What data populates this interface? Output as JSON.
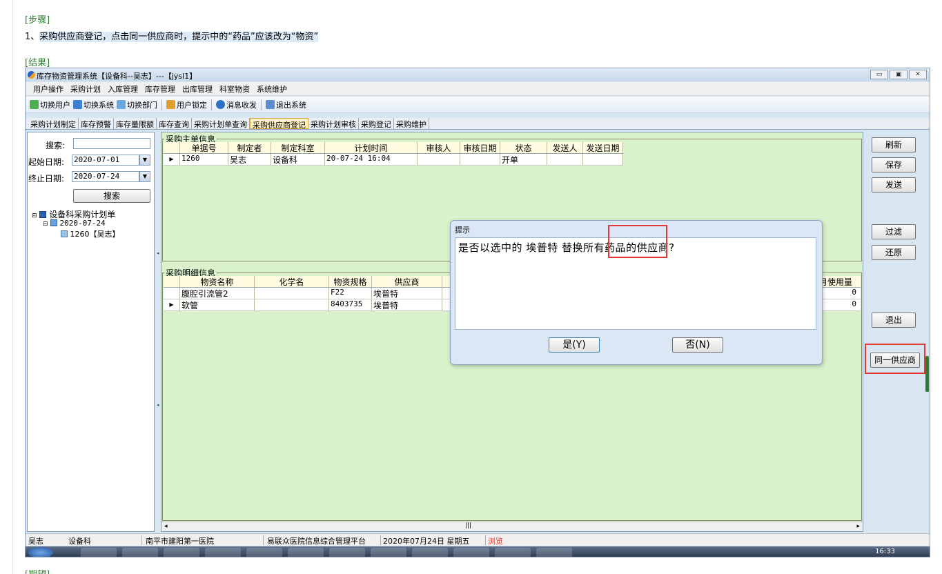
{
  "doc": {
    "steps_heading": "[步骤]",
    "step_number": "1、",
    "step_text": "采购供应商登记，点击同一供应商时，提示中的“药品”应该改为“物资”",
    "result_heading": "[结果]",
    "expected_heading": "[期望]"
  },
  "window": {
    "title": "库存物资管理系统【设备科--吴志】---【jysl1】",
    "controls": [
      "▭",
      "▣",
      "✕"
    ]
  },
  "menu": [
    "用户操作",
    "采购计划",
    "入库管理",
    "库存管理",
    "出库管理",
    "科室物资",
    "系统维护"
  ],
  "toolbar": {
    "switch_user": "切换用户",
    "switch_system": "切换系统",
    "switch_dept": "切换部门",
    "lock_user": "用户锁定",
    "messages": "消息收发",
    "exit_system": "退出系统"
  },
  "tabs": [
    "采购计划制定",
    "库存预警",
    "库存量限额",
    "库存查询",
    "采购计划单查询",
    "采购供应商登记",
    "采购计划审核",
    "采购登记",
    "采购维护"
  ],
  "active_tab": "采购供应商登记",
  "left": {
    "search_label": "搜索:",
    "search_value": "",
    "start_label": "起始日期:",
    "start_value": "2020-07-01",
    "end_label": "终止日期:",
    "end_value": "2020-07-24",
    "search_button": "搜索",
    "tree_root": "设备科采购计划单",
    "tree_date": "2020-07-24",
    "tree_leaf": "1260【吴志】"
  },
  "master": {
    "title": "采购主单信息",
    "columns": [
      "单据号",
      "制定者",
      "制定科室",
      "计划时间",
      "审核人",
      "审核日期",
      "状态",
      "发送人",
      "发送日期"
    ],
    "row": [
      "1260",
      "吴志",
      "设备科",
      "20-07-24 16:04",
      "",
      "",
      "开单",
      "",
      ""
    ]
  },
  "detail": {
    "title": "采购明细信息",
    "columns": [
      "物资名称",
      "化学名",
      "物资规格",
      "供应商"
    ],
    "last_column": "月使用量",
    "rows": [
      {
        "name": "腹腔引流管2",
        "chem": "",
        "spec": "F22",
        "supplier": "埃普特",
        "extra": "",
        "monthly": "0"
      },
      {
        "name": "软管",
        "chem": "",
        "spec": "8403735",
        "supplier": "埃普特",
        "extra": "",
        "monthly": "0"
      }
    ]
  },
  "right_buttons": {
    "refresh": "刷新",
    "save": "保存",
    "send": "发送",
    "filter": "过滤",
    "restore": "还原",
    "exit": "退出",
    "same_supplier": "同一供应商"
  },
  "dialog": {
    "title": "提示",
    "message_before": "是否以选中的 埃普特 替换",
    "message_highlight": "所有药品",
    "message_after": "的供应商?",
    "yes": "是(Y)",
    "no": "否(N)"
  },
  "status": {
    "user": "吴志",
    "dept": "设备科",
    "hospital": "南平市建阳第一医院",
    "platform": "易联众医院信息综合管理平台",
    "date": "2020年07月24日 星期五",
    "mode": "浏览"
  },
  "taskbar": {
    "clock": "16:33"
  },
  "colors": {
    "doc_heading": "#2f7d32",
    "highlight_box": "#e53935",
    "grid_background": "#d9f2cc",
    "active_tab": "#fff2c4",
    "status_mode": "#e53935"
  }
}
